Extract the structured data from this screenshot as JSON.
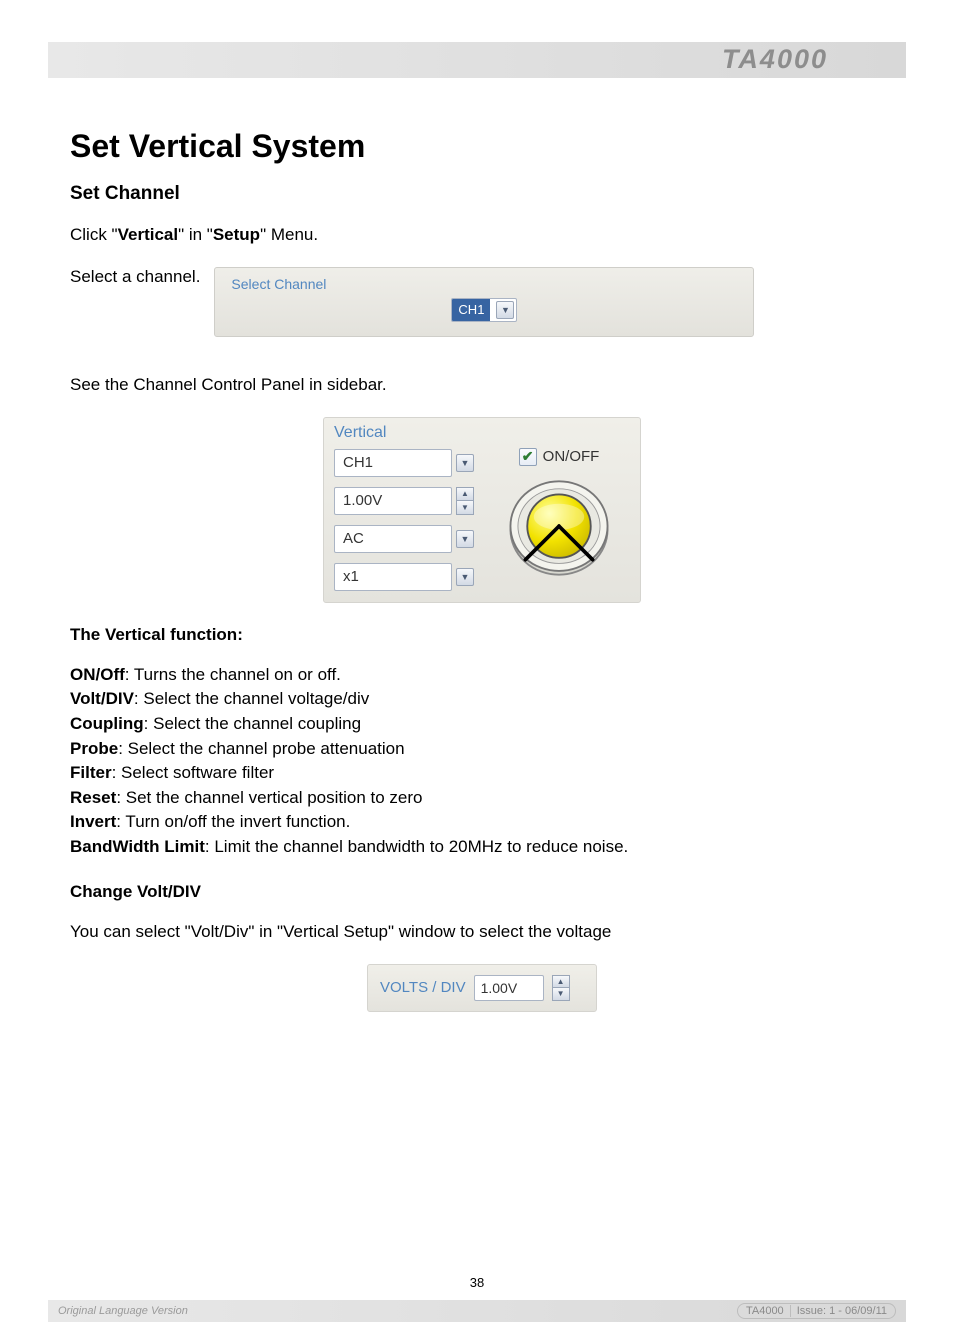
{
  "header": {
    "brand": "TA4000"
  },
  "page_title": "Set Vertical System",
  "section1": {
    "heading": "Set Channel",
    "line1_pre": "Click \"",
    "line1_b1": "Vertical",
    "line1_mid": "\" in \"",
    "line1_b2": "Setup",
    "line1_post": "\" Menu.",
    "line2": "Select a channel."
  },
  "select_channel": {
    "legend": "Select Channel",
    "value": "CH1"
  },
  "section2": {
    "line": "See the Channel Control Panel in sidebar."
  },
  "vertical_panel": {
    "legend": "Vertical",
    "channel": "CH1",
    "voltdiv": "1.00V",
    "coupling": "AC",
    "probe": "x1",
    "onoff_label": "ON/OFF",
    "onoff_checked": true
  },
  "functions": {
    "heading": "The Vertical function:",
    "items": [
      {
        "name": "ON/Off",
        "desc": ": Turns the channel on or off."
      },
      {
        "name": "Volt/DIV",
        "desc": ": Select the channel voltage/div"
      },
      {
        "name": "Coupling",
        "desc": ": Select the channel coupling"
      },
      {
        "name": "Probe",
        "desc": ": Select the channel probe attenuation"
      },
      {
        "name": "Filter",
        "desc": ": Select software filter"
      },
      {
        "name": "Reset",
        "desc": ": Set the channel vertical position to zero"
      },
      {
        "name": "Invert",
        "desc": ": Turn on/off the invert function."
      },
      {
        "name": "BandWidth Limit",
        "desc": ": Limit the channel bandwidth to 20MHz to reduce noise."
      }
    ]
  },
  "change_voltdiv": {
    "heading": "Change Volt/DIV",
    "line": "You can select \"Volt/Div\" in \"Vertical Setup\" window to select the voltage",
    "label": "VOLTS / DIV",
    "value": "1.00V"
  },
  "page_number": "38",
  "footer": {
    "left": "Original Language Version",
    "chip_left": "TA4000",
    "chip_right": "Issue: 1 - 06/09/11"
  }
}
